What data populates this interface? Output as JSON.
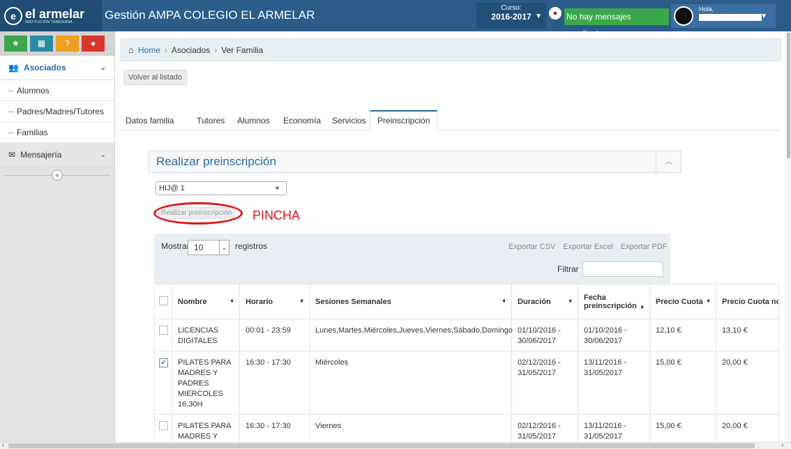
{
  "brand": {
    "name": "el armelar",
    "sub": "INSTITUCIÓN TERESIANA",
    "ampa": "AMPA"
  },
  "app_title": "Gestión AMPA COLEGIO EL ARMELAR",
  "curso": {
    "label": "Curso:",
    "value": "2016-2017"
  },
  "messages": "No hay mensajes pendientes",
  "user": {
    "greeting": "Hola,"
  },
  "sidebar": {
    "groups": [
      {
        "label": "Asociados",
        "items": [
          "Alumnos",
          "Padres/Madres/Tutores",
          "Familias"
        ]
      },
      {
        "label": "Mensajería"
      }
    ]
  },
  "breadcrumb": {
    "home": "Home",
    "section": "Asociados",
    "page": "Ver Familia"
  },
  "back_button": "Volver al listado",
  "tabs": [
    "Datos familia",
    "Tutores",
    "Alumnos",
    "Economía",
    "Servicios",
    "Preinscripción"
  ],
  "active_tab": "Preinscripción",
  "panel": {
    "title": "Realizar preinscripción"
  },
  "child_select": {
    "value": "HIJ@ 1"
  },
  "preinscripcion_button": "Realizar preinscripción",
  "annotation": "PINCHA",
  "datatable": {
    "show_label": "Mostrar",
    "page_length": "10",
    "records_label": "registros",
    "export_buttons": [
      "Exportar CSV",
      "Exportar Excel",
      "Exportar PDF"
    ],
    "filter_label": "Filtrar",
    "columns": [
      "Nombre",
      "Horario",
      "Sesiones Semanales",
      "Duración",
      "Fecha preinscripción",
      "Precio Cuota",
      "Precio Cuota no socio"
    ],
    "rows": [
      {
        "checked": false,
        "nombre": "LICENCIAS DIGITALES",
        "horario": "00:01 - 23:59",
        "sesiones": "Lunes,Martes,Miércoles,Jueves,Viernes,Sábado,Domingo",
        "duracion": "01/10/2016 - 30/06/2017",
        "fecha": "01/10/2016 - 30/06/2017",
        "precio": "12,10 €",
        "precio_no_socio": "13,10 €"
      },
      {
        "checked": true,
        "nombre": "PILATES PARA MADRES Y PADRES MIERCOLES 16,30H",
        "horario": "16:30 - 17:30",
        "sesiones": "Miércoles",
        "duracion": "02/12/2016 - 31/05/2017",
        "fecha": "13/11/2016 - 31/05/2017",
        "precio": "15,00 €",
        "precio_no_socio": "20,00 €"
      },
      {
        "checked": false,
        "nombre": "PILATES PARA MADRES Y",
        "horario": "16:30 - 17:30",
        "sesiones": "Viernes",
        "duracion": "02/12/2016 - 31/05/2017",
        "fecha": "13/11/2016 - 31/05/2017",
        "precio": "15,00 €",
        "precio_no_socio": "20,00 €"
      }
    ]
  },
  "colors": {
    "navbar": "#2b5c8a",
    "accent": "#2c6aa0",
    "success": "#3aa84a",
    "annotation": "#e01616"
  }
}
